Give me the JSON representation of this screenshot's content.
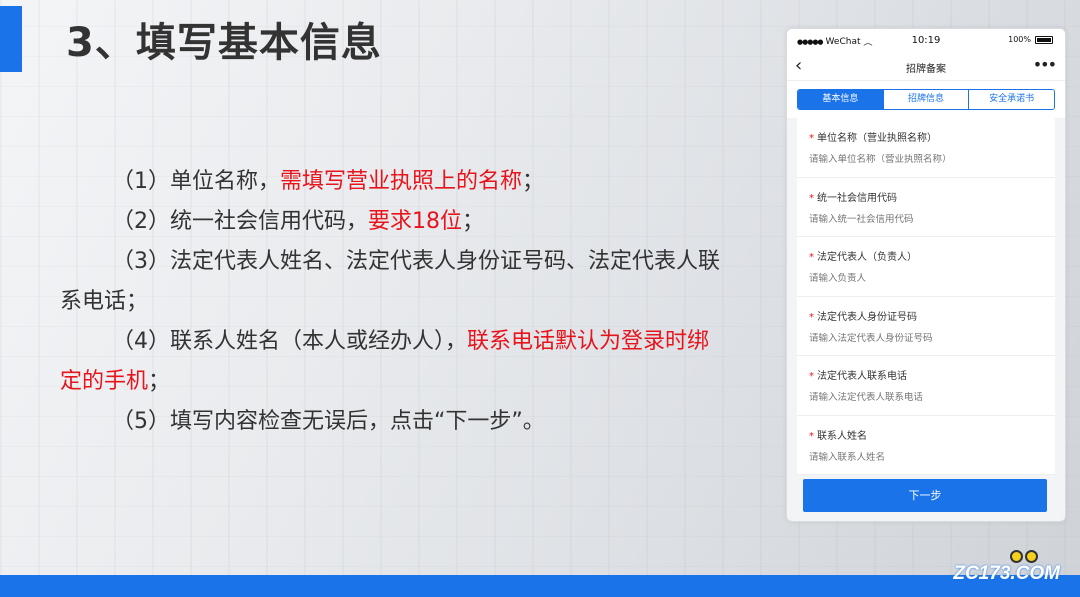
{
  "slide": {
    "title": "3、填写基本信息",
    "paragraphs": [
      {
        "prefix": "（1）单位名称，",
        "highlight": "需填写营业执照上的名称",
        "suffix": "；"
      },
      {
        "prefix": "（2）统一社会信用代码，",
        "highlight": "要求18位",
        "suffix": "；"
      },
      {
        "prefix": "（3）法定代表人姓名、法定代表人身份证号码、法定代表人联系电话；",
        "highlight": "",
        "suffix": ""
      },
      {
        "prefix": "（4）联系人姓名（本人或经办人），",
        "highlight": "联系电话默认为登录时绑定的手机",
        "suffix": "；"
      },
      {
        "prefix": "（5）填写内容检查无误后，点击“下一步”。",
        "highlight": "",
        "suffix": ""
      }
    ]
  },
  "phone": {
    "status": {
      "carrier": "WeChat",
      "time": "10:19",
      "battery": "100%"
    },
    "nav": {
      "back_icon": "chevron-left-icon",
      "title": "招牌备案",
      "more_icon": "more-icon"
    },
    "tabs": [
      {
        "label": "基本信息",
        "active": true
      },
      {
        "label": "招牌信息",
        "active": false
      },
      {
        "label": "安全承诺书",
        "active": false
      }
    ],
    "fields": [
      {
        "label": "单位名称（营业执照名称）",
        "placeholder": "请输入单位名称（营业执照名称）"
      },
      {
        "label": "统一社会信用代码",
        "placeholder": "请输入统一社会信用代码"
      },
      {
        "label": "法定代表人（负责人）",
        "placeholder": "请输入负责人"
      },
      {
        "label": "法定代表人身份证号码",
        "placeholder": "请输入法定代表人身份证号码"
      },
      {
        "label": "法定代表人联系电话",
        "placeholder": "请输入法定代表人联系电话"
      },
      {
        "label": "联系人姓名",
        "placeholder": "请输入联系人姓名"
      }
    ],
    "required_mark": "*",
    "next_button": "下一步"
  },
  "logo": {
    "text": "ZC173.COM"
  },
  "colors": {
    "accent": "#1a73e8",
    "highlight": "#e8141b",
    "title": "#333333"
  }
}
